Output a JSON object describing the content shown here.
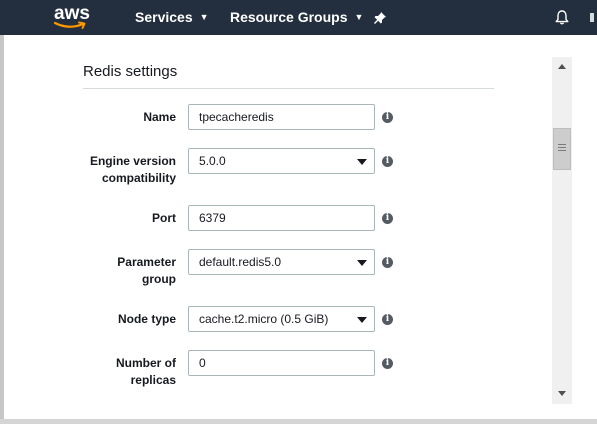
{
  "topnav": {
    "logo_text": "aws",
    "services_label": "Services",
    "resource_groups_label": "Resource Groups",
    "pin_icon": "pin-icon",
    "bell_icon": "bell-icon",
    "background": "#232f3e"
  },
  "panel": {
    "title": "Redis settings",
    "fields": [
      {
        "label": "Name",
        "value": "tpecacheredis",
        "kind": "text"
      },
      {
        "label_line1": "Engine version",
        "label_line2": "compatibility",
        "value": "5.0.0",
        "kind": "select"
      },
      {
        "label": "Port",
        "value": "6379",
        "kind": "text"
      },
      {
        "label_line1": "Parameter",
        "label_line2": "group",
        "value": "default.redis5.0",
        "kind": "select"
      },
      {
        "label": "Node type",
        "value": "cache.t2.micro (0.5 GiB)",
        "kind": "select"
      },
      {
        "label_line1": "Number of",
        "label_line2": "replicas",
        "value": "0",
        "kind": "text"
      }
    ],
    "info_glyph": "i"
  }
}
